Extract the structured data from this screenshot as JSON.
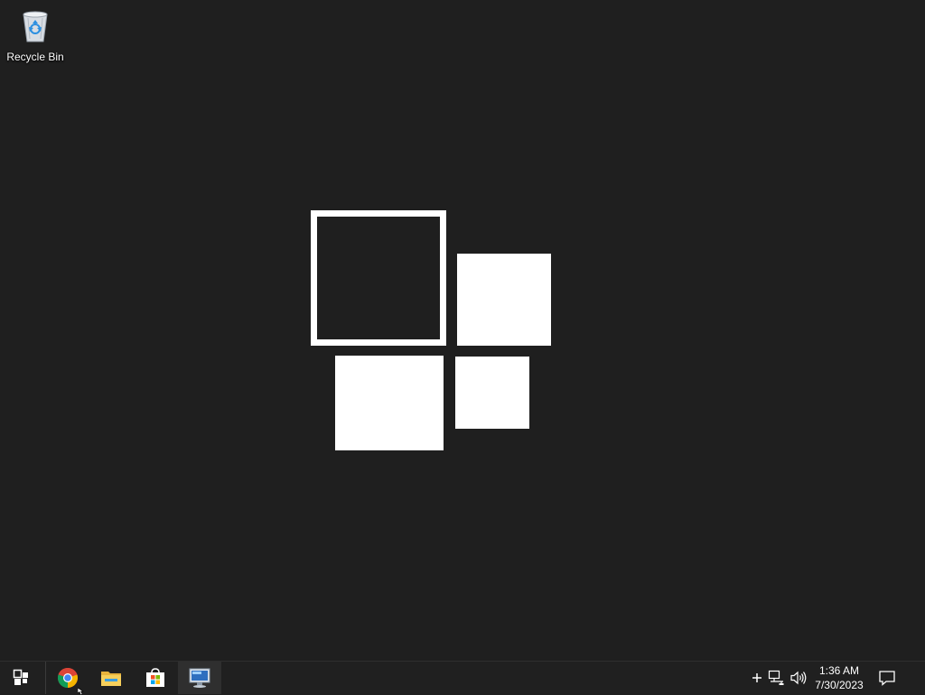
{
  "desktop": {
    "background_color": "#1f1f1f",
    "icons": [
      {
        "label": "Recycle Bin",
        "icon": "recycle-bin-icon"
      }
    ],
    "wallpaper_logo": "windows-server-logo"
  },
  "taskbar": {
    "start_icon": "start-icon",
    "pinned_apps": [
      {
        "name": "Google Chrome",
        "icon": "chrome-icon"
      },
      {
        "name": "File Explorer",
        "icon": "file-explorer-icon"
      },
      {
        "name": "Microsoft Store",
        "icon": "store-icon"
      },
      {
        "name": "Remote Desktop Connection",
        "icon": "remote-desktop-icon",
        "active": true
      }
    ],
    "tray": {
      "icons": [
        "show-hidden-icons-plus-icon",
        "network-icon",
        "volume-icon"
      ],
      "time": "1:36 AM",
      "date": "7/30/2023",
      "notification_icon": "action-center-icon"
    }
  }
}
